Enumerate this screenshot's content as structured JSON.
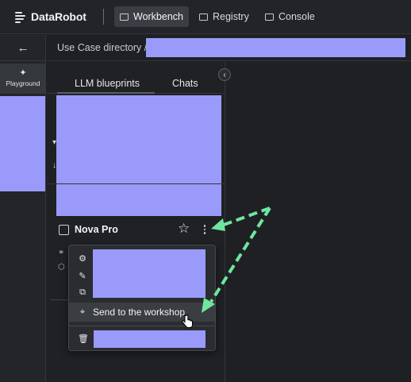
{
  "app": {
    "logo_text": "DataRobot",
    "nav": [
      {
        "label": "Workbench",
        "icon": "workbench-icon",
        "active": true
      },
      {
        "label": "Registry",
        "icon": "registry-icon",
        "active": false
      },
      {
        "label": "Console",
        "icon": "console-icon",
        "active": false
      }
    ]
  },
  "rail": {
    "back_icon": "arrow-left-icon",
    "playground_label": "Playground",
    "playground_icon": "sparkle-icon"
  },
  "breadcrumb": {
    "text": "Use Case directory /"
  },
  "panel": {
    "tabs": [
      {
        "label": "LLM blueprints",
        "active": true
      },
      {
        "label": "Chats",
        "active": false
      }
    ],
    "blueprint": {
      "name": "Nova Pro",
      "starred": false
    }
  },
  "menu": {
    "items": [
      {
        "icon": "gear-icon",
        "label": ""
      },
      {
        "icon": "pencil-icon",
        "label": ""
      },
      {
        "icon": "copy-icon",
        "label": ""
      },
      {
        "icon": "workshop-icon",
        "label": "Send to the workshop",
        "hovered": true
      },
      {
        "icon": "trash-icon",
        "label": ""
      }
    ]
  },
  "colors": {
    "redaction": "#9a9afa",
    "arrow": "#6fe6a0",
    "background": "#1e2024"
  }
}
